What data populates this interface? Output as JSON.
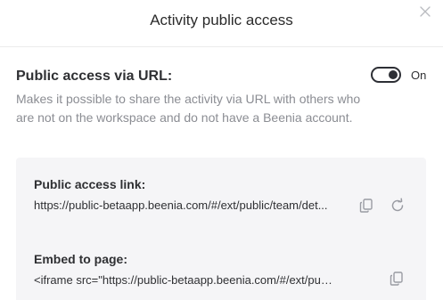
{
  "dialog": {
    "title": "Activity public access"
  },
  "public_access": {
    "title": "Public access via URL:",
    "toggle_state_label": "On",
    "enabled": true,
    "description": "Makes it possible to share the activity via URL with others who are not on the workspace and do not have a Beenia account."
  },
  "public_link": {
    "label": "Public access link:",
    "value": "https://public-betaapp.beenia.com/#/ext/public/team/det..."
  },
  "embed": {
    "label": "Embed to page:",
    "value": "<iframe src=\"https://public-betaapp.beenia.com/#/ext/public/t..."
  },
  "icons": {
    "close": "close-icon",
    "copy": "copy-icon",
    "regenerate": "refresh-icon"
  },
  "colors": {
    "panel_background": "#f5f5f7",
    "toggle": "#2d2f35",
    "description_text": "#8b8d93",
    "icon": "#9a9ca3"
  }
}
